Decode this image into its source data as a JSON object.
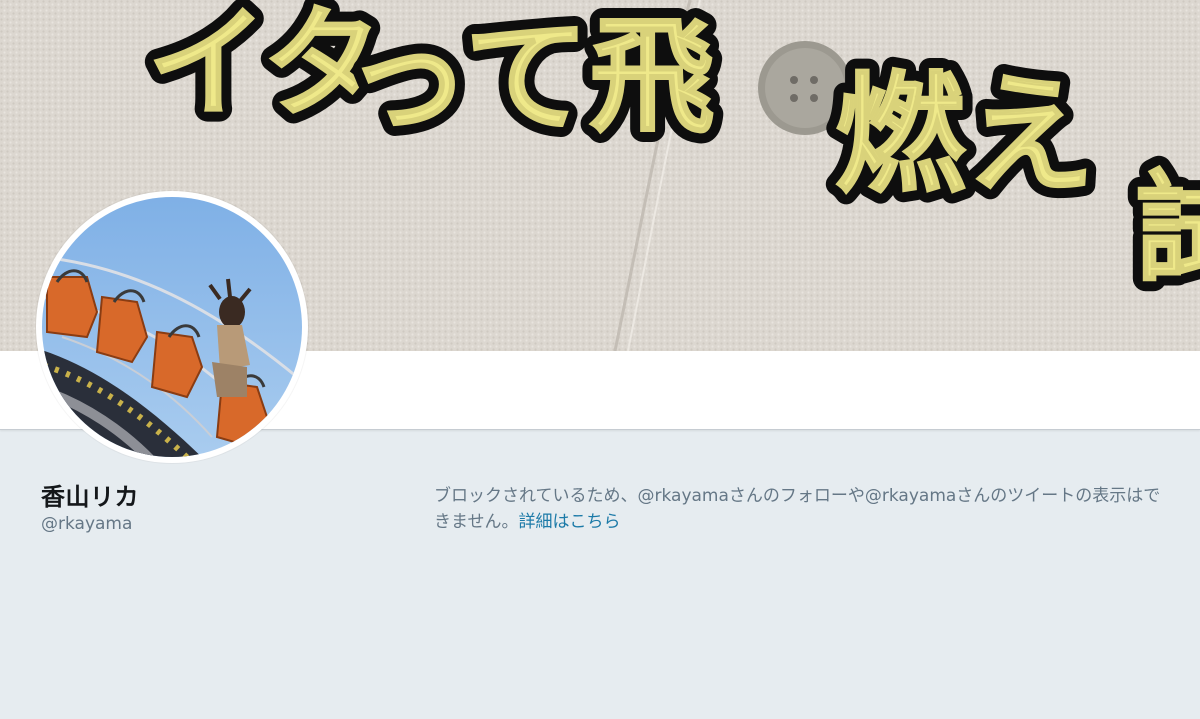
{
  "profile": {
    "name": "香山リカ",
    "handle": "@rkayama"
  },
  "blocked_notice": {
    "text": "ブロックされているため、@rkayamaさんのフォローや@rkayamaさんのツイートの表示はできません。",
    "link_label": "詳細はこちら"
  },
  "banner": {
    "embroidered_text": [
      "イタ",
      "って飛",
      "燃え",
      "試"
    ]
  },
  "colors": {
    "page_background": "#e6ecf0",
    "name_text": "#14171a",
    "secondary_text": "#657786",
    "link": "#1c7aa8",
    "embroidery_yellow": "#f0ec8c",
    "embroidery_outline": "#111111"
  }
}
